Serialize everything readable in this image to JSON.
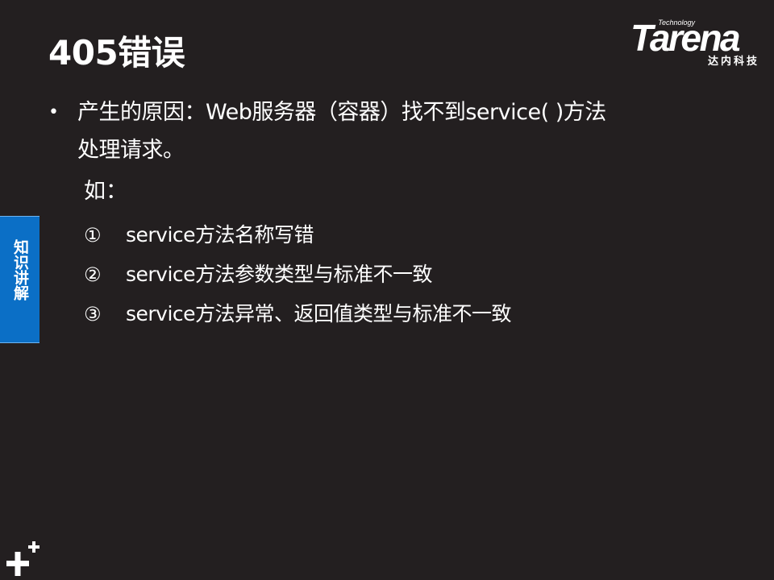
{
  "slide": {
    "title": "405错误",
    "bullet": {
      "line1": "产生的原因：Web服务器（容器）找不到service( )方法",
      "line2": "处理请求。"
    },
    "example_label": "如：",
    "items": [
      {
        "num": "①",
        "text": "service方法名称写错"
      },
      {
        "num": "②",
        "text": "service方法参数类型与标准不一致"
      },
      {
        "num": "③",
        "text": "service方法异常、返回值类型与标准不一致"
      }
    ]
  },
  "logo": {
    "tagline": "Technology",
    "word": "Tarena",
    "chinese": "达内科技"
  },
  "side_tab": {
    "label": "知识讲解"
  },
  "icons": {
    "bullet": "bullet-dot-icon",
    "corner": "plus-plus-icon"
  },
  "colors": {
    "background": "#231f20",
    "text": "#ffffff",
    "side_tab": "#0b6fc6"
  }
}
